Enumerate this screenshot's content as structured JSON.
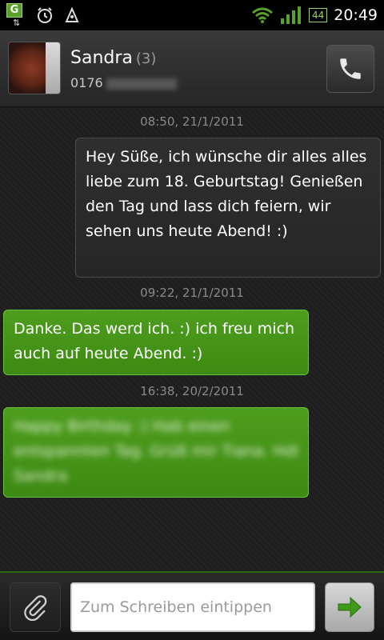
{
  "status_bar": {
    "time": "20:49",
    "battery_text": "44",
    "icons": [
      "g-sync-icon",
      "alarm-icon",
      "usb-debug-icon",
      "wifi-icon",
      "signal-icon",
      "battery-icon"
    ]
  },
  "header": {
    "contact_name": "Sandra",
    "message_count": "(3)",
    "number_prefix": "0176",
    "call_icon": "phone-icon"
  },
  "messages": [
    {
      "timestamp": "08:50, 21/1/2011",
      "direction": "sent",
      "text": "Hey Süße, ich wünsche dir alles alles liebe zum 18. Geburtstag! Genießen den Tag und lass dich feiern, wir sehen uns heute Abend! :)"
    },
    {
      "timestamp": "09:22, 21/1/2011",
      "direction": "received",
      "text": "Danke. Das werd ich. :) ich freu mich auch auf heute Abend. :)"
    },
    {
      "timestamp": "16:38, 20/2/2011",
      "direction": "received",
      "text": "Happy Birthday :) Hab einen entspannten Tag. Grüß mir Tiana. Hdl Sandra"
    }
  ],
  "composer": {
    "placeholder": "Zum Schreiben eintippen",
    "attach_icon": "paperclip-icon",
    "send_icon": "send-arrow-icon"
  },
  "colors": {
    "received_bubble": "#4a9a1c",
    "sent_bubble": "#2c2c2c",
    "accent": "#5aa02c"
  }
}
